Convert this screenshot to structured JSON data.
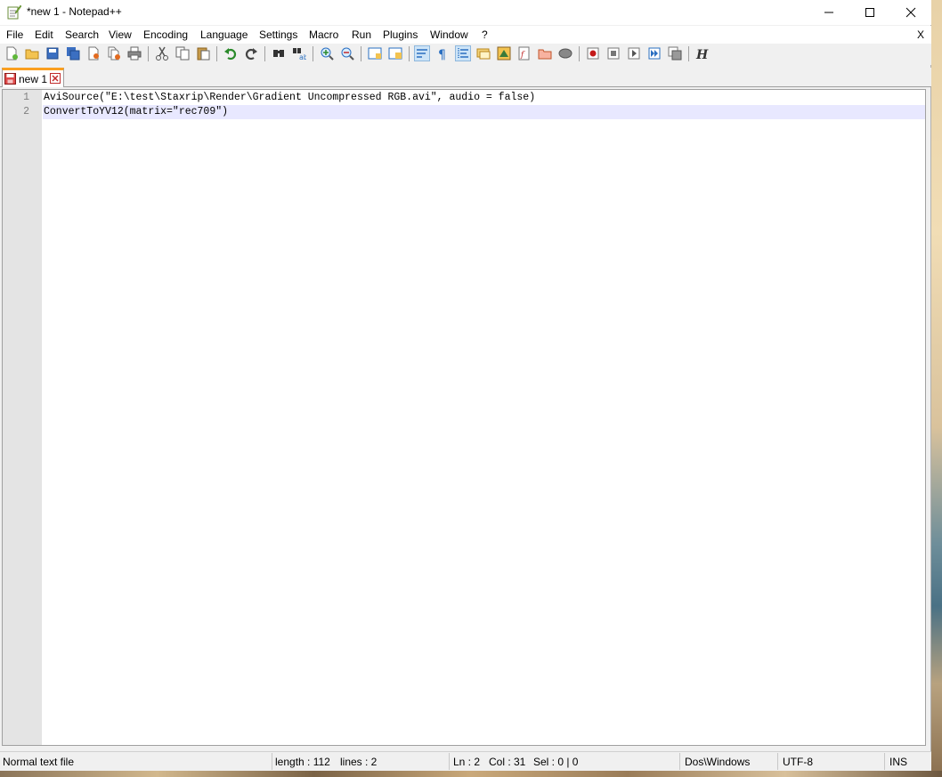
{
  "window": {
    "title": "*new 1 - Notepad++"
  },
  "menu": {
    "items": [
      "File",
      "Edit",
      "Search",
      "View",
      "Encoding",
      "Language",
      "Settings",
      "Macro",
      "Run",
      "Plugins",
      "Window",
      "?"
    ],
    "close_label": "X"
  },
  "toolbar": {
    "icons": [
      "new-file-icon",
      "open-file-icon",
      "save-icon",
      "save-all-icon",
      "close-icon",
      "close-all-icon",
      "print-icon",
      "cut-icon",
      "copy-icon",
      "paste-icon",
      "undo-icon",
      "redo-icon",
      "find-icon",
      "replace-icon",
      "zoom-in-icon",
      "zoom-out-icon",
      "sync-vertical-icon",
      "sync-horizontal-icon",
      "word-wrap-icon",
      "show-all-chars-icon",
      "indent-guide-icon",
      "doc-map-icon",
      "function-list-icon",
      "folder-as-workspace-icon",
      "monitoring-icon",
      "record-macro-icon",
      "stop-record-icon",
      "play-macro-icon",
      "run-macro-multiple-icon",
      "save-macro-icon",
      "html-tag-icon"
    ],
    "active": [
      "word-wrap-icon",
      "indent-guide-icon"
    ]
  },
  "tabs": [
    {
      "label": "new 1",
      "modified": true
    }
  ],
  "editor": {
    "lines": [
      {
        "number": "1",
        "text": "AviSource(\"E:\\test\\Staxrip\\Render\\Gradient Uncompressed RGB.avi\", audio = false)"
      },
      {
        "number": "2",
        "text": "ConvertToYV12(matrix=\"rec709\")"
      }
    ],
    "current_line": 2
  },
  "status": {
    "file_type": "Normal text file",
    "length": "length : 112",
    "lines": "lines : 2",
    "ln": "Ln : 2",
    "col": "Col : 31",
    "sel": "Sel : 0 | 0",
    "eol": "Dos\\Windows",
    "encoding": "UTF-8",
    "mode": "INS"
  },
  "colors": {
    "tab_accent": "#fa9f20",
    "current_line_bg": "#e8e8ff",
    "gutter_bg": "#e4e4e4"
  }
}
